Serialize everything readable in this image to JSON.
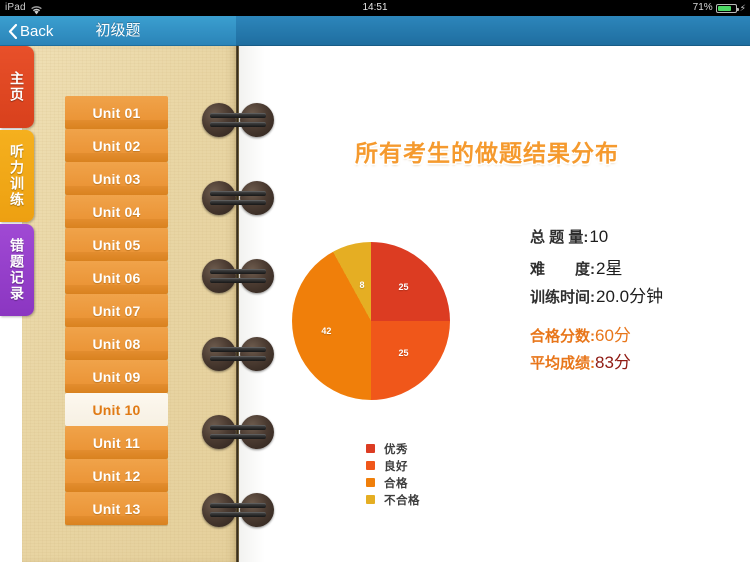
{
  "statusbar": {
    "device": "iPad",
    "wifi_icon": "wifi-icon",
    "time": "14:51",
    "battery_percent": "71%",
    "battery_icon": "battery-icon",
    "charging_icon": "lightning-bolt-icon"
  },
  "navbar": {
    "back_label": "Back",
    "back_icon": "chevron-left-icon",
    "title": "初级题"
  },
  "tabs": [
    {
      "label": "主页",
      "color": "#e8502a"
    },
    {
      "label": "听力训练",
      "color": "#f5b01e"
    },
    {
      "label": "错题记录",
      "color": "#a049d4"
    }
  ],
  "units": {
    "selected": "Unit 10",
    "items": [
      "Unit 01",
      "Unit 02",
      "Unit 03",
      "Unit 04",
      "Unit 05",
      "Unit 06",
      "Unit 07",
      "Unit 08",
      "Unit 09",
      "Unit 10",
      "Unit 11",
      "Unit 12",
      "Unit 13"
    ]
  },
  "content": {
    "title": "所有考生的做题结果分布"
  },
  "stats": {
    "rows": [
      {
        "key": "总 题 量",
        "colon": ":",
        "value": "10"
      },
      {
        "key": "难　　度",
        "colon": ":",
        "value": "2星"
      },
      {
        "key": "训练时间",
        "colon": ":",
        "value": "20.0分钟"
      }
    ],
    "highlight_rows": [
      {
        "key": "合格分数",
        "colon": ":",
        "value": "60分",
        "value_color": "#e8761a"
      },
      {
        "key": "平均成绩",
        "colon": ":",
        "value": "83分",
        "value_color": "#8f1a12"
      }
    ]
  },
  "chart_data": {
    "type": "pie",
    "title": "所有考生的做题结果分布",
    "categories": [
      "优秀",
      "良好",
      "合格",
      "不合格"
    ],
    "values": [
      25,
      25,
      42,
      8
    ],
    "value_labels": [
      "25",
      "25",
      "42",
      "8"
    ],
    "colors": [
      "#dc3c22",
      "#f0571a",
      "#f07f0a",
      "#e5ae23"
    ],
    "legend_position": "bottom-left",
    "grid": false,
    "start_angle": 0,
    "direction": "clockwise",
    "units": "percent"
  }
}
